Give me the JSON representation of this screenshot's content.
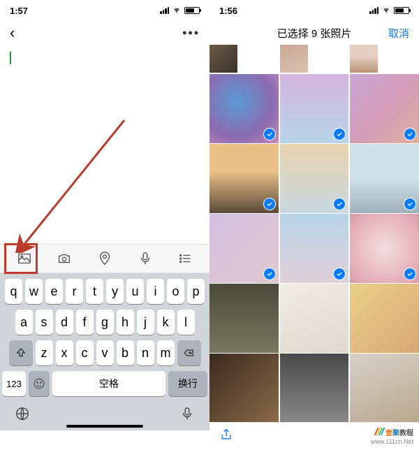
{
  "left": {
    "status_time": "1:57",
    "toolbar_icons": [
      "photo-icon",
      "camera-icon",
      "location-icon",
      "mic-icon",
      "list-icon"
    ],
    "keyboard": {
      "row1": [
        "q",
        "w",
        "e",
        "r",
        "t",
        "y",
        "u",
        "i",
        "o",
        "p"
      ],
      "row2": [
        "a",
        "s",
        "d",
        "f",
        "g",
        "h",
        "j",
        "k",
        "l"
      ],
      "row3": [
        "z",
        "x",
        "c",
        "v",
        "b",
        "n",
        "m"
      ],
      "key_123": "123",
      "key_space": "空格",
      "key_enter": "换行"
    }
  },
  "right": {
    "status_time": "1:56",
    "title": "已选择 9 张照片",
    "cancel": "取消",
    "selected_indices": [
      3,
      4,
      5,
      6,
      7,
      8,
      9,
      10,
      11
    ],
    "thumbs": [
      "g0",
      "g1",
      "g2",
      "g3",
      "g4",
      "g5",
      "g6",
      "g7",
      "g8",
      "g9",
      "g10",
      "g11",
      "g12",
      "g13",
      "g14",
      "g15",
      "g16",
      "g17"
    ]
  },
  "watermark": {
    "brand": "壹聚教程",
    "url": "www.111cn.Net"
  }
}
